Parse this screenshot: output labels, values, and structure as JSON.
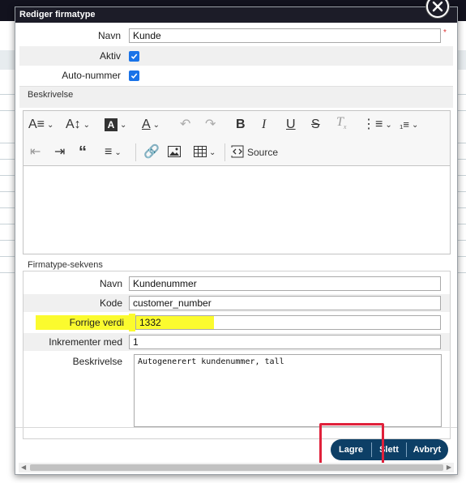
{
  "dialog": {
    "title": "Rediger firmatype"
  },
  "form": {
    "name_label": "Navn",
    "name_value": "Kunde",
    "required_mark": "*",
    "active_label": "Aktiv",
    "active_checked": true,
    "autonumber_label": "Auto-nummer",
    "autonumber_checked": true,
    "description_label": "Beskrivelse"
  },
  "toolbar": {
    "source_label": "Source",
    "icons": [
      "font-size-icon",
      "line-height-icon",
      "highlight-icon",
      "font-color-icon",
      "undo-icon",
      "redo-icon",
      "bold-icon",
      "italic-icon",
      "underline-icon",
      "strikethrough-icon",
      "remove-format-icon",
      "bulleted-list-icon",
      "numbered-list-icon",
      "outdent-icon",
      "indent-icon",
      "blockquote-icon",
      "align-icon",
      "link-icon",
      "image-icon",
      "table-icon",
      "source-icon"
    ]
  },
  "sequence": {
    "section_label": "Firmatype-sekvens",
    "name_label": "Navn",
    "name_value": "Kundenummer",
    "code_label": "Kode",
    "code_value": "customer_number",
    "prev_label": "Forrige verdi",
    "prev_value": "1332",
    "increment_label": "Inkrementer med",
    "increment_value": "1",
    "desc_label": "Beskrivelse",
    "desc_value": "Autogenerert kundenummer, tall"
  },
  "buttons": {
    "save": "Lagre",
    "delete": "Slett",
    "cancel": "Avbryt"
  },
  "colors": {
    "title_bar": "#1c1c28",
    "button_group": "#0d3f66",
    "highlight": "#fbfb2e",
    "annotation_box": "#e0213b",
    "checkbox": "#1a73e8"
  }
}
